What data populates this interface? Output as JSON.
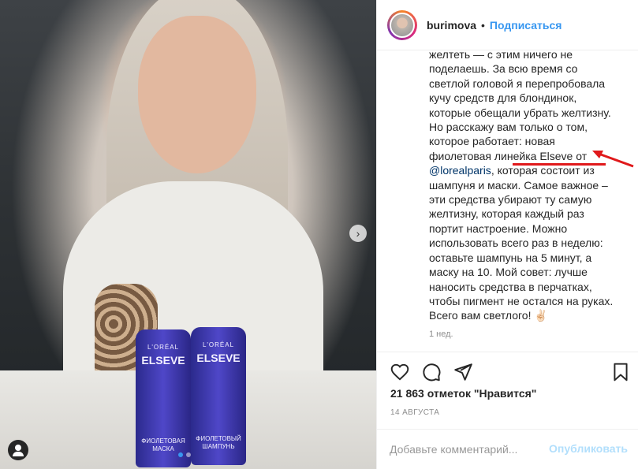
{
  "post": {
    "photo_alt": "photo",
    "bottles": [
      {
        "brand": "L'ORÉAL",
        "name": "ELSEVE",
        "sub": "ФИОЛЕТОВАЯ МАСКА"
      },
      {
        "brand": "L'ORÉAL",
        "name": "ELSEVE",
        "sub": "ФИОЛЕТОВЫЙ ШАМПУНЬ"
      }
    ],
    "next_icon": "chevron-right-icon",
    "user_icon": "user-tag-icon",
    "carousel": {
      "count": 2,
      "active": 1
    }
  },
  "header": {
    "username": "burimova",
    "separator": "•",
    "follow_label": "Подписаться"
  },
  "caption": {
    "before_mention": "желтеть — с этим ничего не поделаешь. За всю время со светлой головой я перепробовала кучу средств для блондинок, которые обещали убрать желтизну. Но расскажу вам только о том, которое работает: новая фиолетовая линейка Elseve от ",
    "mention": "@lorealparis",
    "after_mention": ", которая состоит из шампуня и маски. Самое важное – эти средства убирают ту самую желтизну, которая каждый раз портит настроение. Можно использовать всего раз в неделю: оставьте шампунь на 5 минут, а маску на 10. Мой совет: лучше наносить средства в перчатках, чтобы пигмент не остался на руках. Всего вам светлого! ",
    "emoji": "✌🏻",
    "time_ago": "1 нед."
  },
  "actions": {
    "like_icon": "heart-icon",
    "comment_icon": "comment-icon",
    "share_icon": "share-icon",
    "save_icon": "bookmark-icon"
  },
  "likes_text": "21 863 отметок \"Нравится\"",
  "date_text": "14 АВГУСТА",
  "comment": {
    "placeholder": "Добавьте комментарий...",
    "publish_label": "Опубликовать"
  },
  "annotation": {
    "color": "#e0191b"
  }
}
